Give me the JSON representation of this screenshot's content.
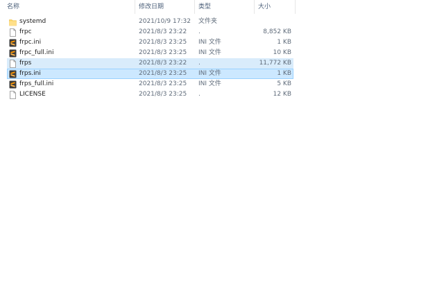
{
  "columns": {
    "name": "名称",
    "modified": "修改日期",
    "type": "类型",
    "size": "大小"
  },
  "files": [
    {
      "name": "systemd",
      "modified": "2021/10/9 17:32",
      "type": "文件夹",
      "size": "",
      "icon": "folder-icon",
      "state": "normal"
    },
    {
      "name": "frpc",
      "modified": "2021/8/3 23:22",
      "type": ".",
      "size": "8,852 KB",
      "icon": "blank-file-icon",
      "state": "normal"
    },
    {
      "name": "frpc.ini",
      "modified": "2021/8/3 23:25",
      "type": "INI 文件",
      "size": "1 KB",
      "icon": "sublime-text-file-icon",
      "state": "normal"
    },
    {
      "name": "frpc_full.ini",
      "modified": "2021/8/3 23:25",
      "type": "INI 文件",
      "size": "10 KB",
      "icon": "sublime-text-file-icon",
      "state": "normal"
    },
    {
      "name": "frps",
      "modified": "2021/8/3 23:22",
      "type": ".",
      "size": "11,772 KB",
      "icon": "blank-file-icon",
      "state": "selected"
    },
    {
      "name": "frps.ini",
      "modified": "2021/8/3 23:25",
      "type": "INI 文件",
      "size": "1 KB",
      "icon": "sublime-text-file-icon",
      "state": "selected"
    },
    {
      "name": "frps_full.ini",
      "modified": "2021/8/3 23:25",
      "type": "INI 文件",
      "size": "5 KB",
      "icon": "sublime-text-file-icon",
      "state": "normal"
    },
    {
      "name": "LICENSE",
      "modified": "2021/8/3 23:25",
      "type": ".",
      "size": "12 KB",
      "icon": "blank-file-icon",
      "state": "normal"
    }
  ],
  "colors": {
    "header_text": "#4c607a",
    "selection_fill": "#cce8ff",
    "selection_border": "#99d1ff",
    "secondary_text": "#5f6b7a",
    "folder": "#ffd766",
    "sublime_bg": "#3b3b3b",
    "sublime_accent": "#ff9800"
  },
  "sort": {
    "indicator_icon": "sort-ascending-caret-icon"
  }
}
